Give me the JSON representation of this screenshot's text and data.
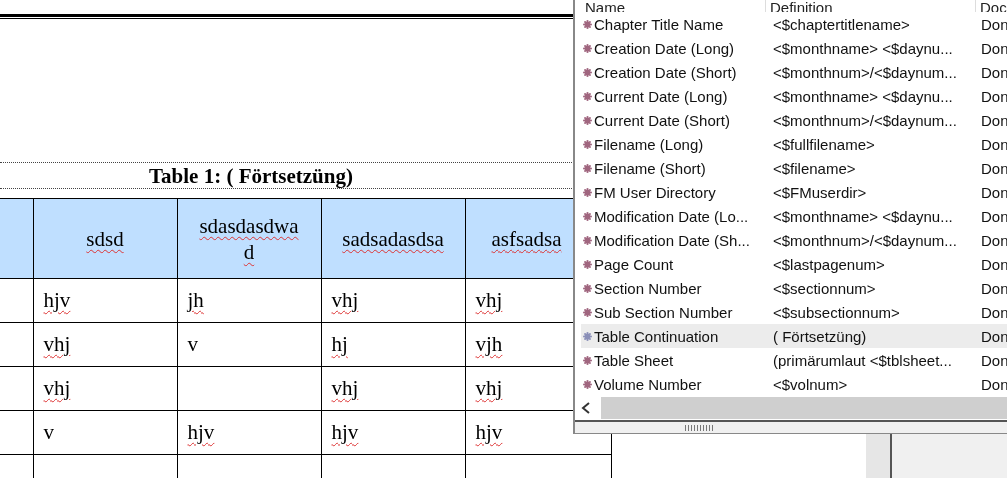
{
  "document": {
    "caption": "Table 1: ( Förtsetzüng)",
    "table": {
      "header": [
        {
          "text": "sdsd",
          "misspelled": true
        },
        {
          "text": "sdasdasdwad",
          "misspelled": true
        },
        {
          "text": "sadsadasdsa",
          "misspelled": true
        },
        {
          "text": "asfsadsa",
          "misspelled": true
        }
      ],
      "rows": [
        [
          {
            "text": "hjv",
            "misspelled": true
          },
          {
            "text": "jh",
            "misspelled": true
          },
          {
            "text": "vhj",
            "misspelled": true
          },
          {
            "text": "vhj",
            "misspelled": true
          }
        ],
        [
          {
            "text": "vhj",
            "misspelled": true
          },
          {
            "text": "v",
            "misspelled": false
          },
          {
            "text": "hj",
            "misspelled": true
          },
          {
            "text": "vjh",
            "misspelled": true
          }
        ],
        [
          {
            "text": "vhj",
            "misspelled": true
          },
          null,
          {
            "text": "vhj",
            "misspelled": true
          },
          {
            "text": "vhj",
            "misspelled": true
          }
        ],
        [
          {
            "text": "v",
            "misspelled": false
          },
          {
            "text": "hjv",
            "misspelled": true
          },
          {
            "text": "hjv",
            "misspelled": true
          },
          {
            "text": "hjv",
            "misspelled": true
          }
        ]
      ]
    }
  },
  "variables_panel": {
    "columns": [
      "Name",
      "Definition",
      "Doc"
    ],
    "rows": [
      {
        "name": "Chapter Title Name",
        "definition": "<$chaptertitlename>",
        "doc": "Don",
        "selected": false
      },
      {
        "name": "Creation Date (Long)",
        "definition": "<$monthname> <$daynu...",
        "doc": "Don",
        "selected": false
      },
      {
        "name": "Creation Date (Short)",
        "definition": "<$monthnum>/<$daynum...",
        "doc": "Don",
        "selected": false
      },
      {
        "name": "Current Date (Long)",
        "definition": "<$monthname> <$daynu...",
        "doc": "Don",
        "selected": false
      },
      {
        "name": "Current Date (Short)",
        "definition": "<$monthnum>/<$daynum...",
        "doc": "Don",
        "selected": false
      },
      {
        "name": "Filename (Long)",
        "definition": "<$fullfilename>",
        "doc": "Don",
        "selected": false
      },
      {
        "name": "Filename (Short)",
        "definition": "<$filename>",
        "doc": "Don",
        "selected": false
      },
      {
        "name": "FM User Directory",
        "definition": "<$FMuserdir>",
        "doc": "Don",
        "selected": false
      },
      {
        "name": "Modification Date (Lo...",
        "definition": "<$monthname> <$daynu...",
        "doc": "Don",
        "selected": false
      },
      {
        "name": "Modification Date (Sh...",
        "definition": "<$monthnum>/<$daynum...",
        "doc": "Don",
        "selected": false
      },
      {
        "name": "Page Count",
        "definition": "<$lastpagenum>",
        "doc": "Don",
        "selected": false
      },
      {
        "name": "Section Number",
        "definition": "<$sectionnum>",
        "doc": "Don",
        "selected": false
      },
      {
        "name": "Sub Section Number",
        "definition": "<$subsectionnum>",
        "doc": "Don",
        "selected": false
      },
      {
        "name": "Table Continuation",
        "definition": "( Förtsetzüng)",
        "doc": "Don",
        "selected": true
      },
      {
        "name": "Table Sheet",
        "definition": " (primärumlaut <$tblsheet...",
        "doc": "Don",
        "selected": false
      },
      {
        "name": "Volume Number",
        "definition": "<$volnum>",
        "doc": "Don",
        "selected": false
      }
    ]
  }
}
